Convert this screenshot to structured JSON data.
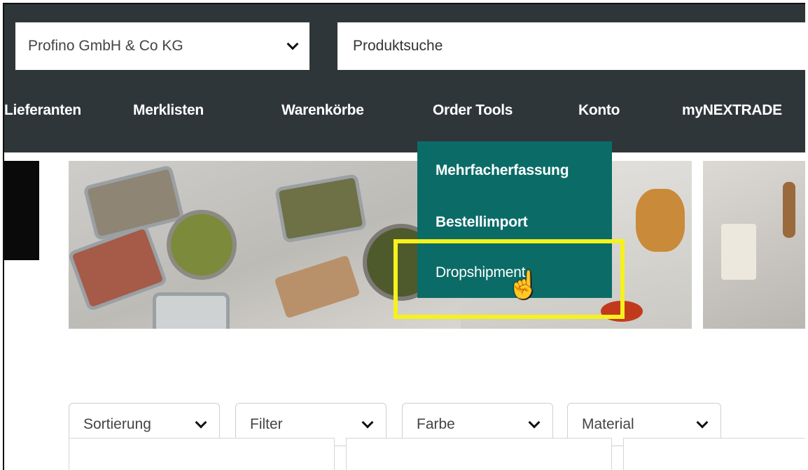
{
  "header": {
    "company_select": {
      "value": "Profino GmbH & Co KG",
      "icon": "chevron-down-icon"
    },
    "search": {
      "placeholder": "Produktsuche"
    }
  },
  "nav": {
    "items": [
      {
        "label": "Lieferanten"
      },
      {
        "label": "Merklisten"
      },
      {
        "label": "Warenkörbe"
      },
      {
        "label": "Order Tools"
      },
      {
        "label": "Konto"
      },
      {
        "label": "myNEXTRADE"
      }
    ]
  },
  "order_tools_menu": {
    "items": [
      {
        "label": "Mehrfacherfassung"
      },
      {
        "label": "Bestellimport"
      },
      {
        "label": "Dropshipment"
      }
    ],
    "background": "#0b6b67",
    "highlight_color": "#f5f21c"
  },
  "filters": [
    {
      "label": "Sortierung"
    },
    {
      "label": "Filter"
    },
    {
      "label": "Farbe"
    },
    {
      "label": "Material"
    }
  ],
  "colors": {
    "topbar": "#2f3639",
    "nav_text": "#ffffff"
  }
}
